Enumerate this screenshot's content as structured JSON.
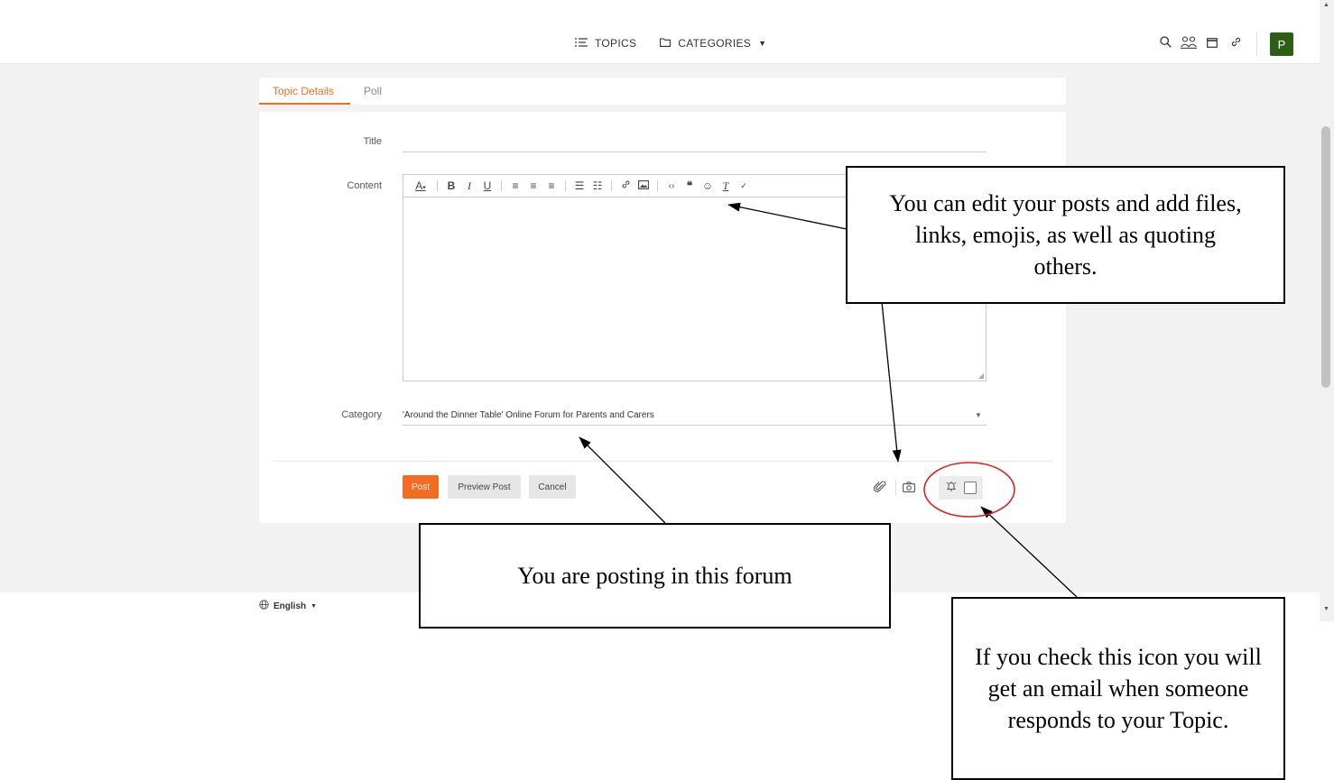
{
  "nav": {
    "topics_label": "TOPICS",
    "categories_label": "CATEGORIES",
    "avatar_initial": "P"
  },
  "tabs": [
    {
      "label": "Topic Details",
      "active": true
    },
    {
      "label": "Poll",
      "active": false
    }
  ],
  "form": {
    "title_label": "Title",
    "title_value": "",
    "content_label": "Content",
    "content_value": "",
    "category_label": "Category",
    "category_value": "'Around the Dinner Table' Online Forum for Parents and Carers"
  },
  "actions": {
    "post_label": "Post",
    "preview_label": "Preview Post",
    "cancel_label": "Cancel"
  },
  "watch_checked": false,
  "footer": {
    "language_label": "English"
  },
  "callouts": {
    "editor_note": "You can edit your posts and add files, links, emojis, as well as quoting others.",
    "forum_note": "You are posting in this forum",
    "email_note": "If you check this icon you will get an email when someone responds to your Topic."
  },
  "colors": {
    "accent": "#f36c21",
    "avatar_bg": "#2e5d14",
    "highlight_circle": "#e02020"
  }
}
